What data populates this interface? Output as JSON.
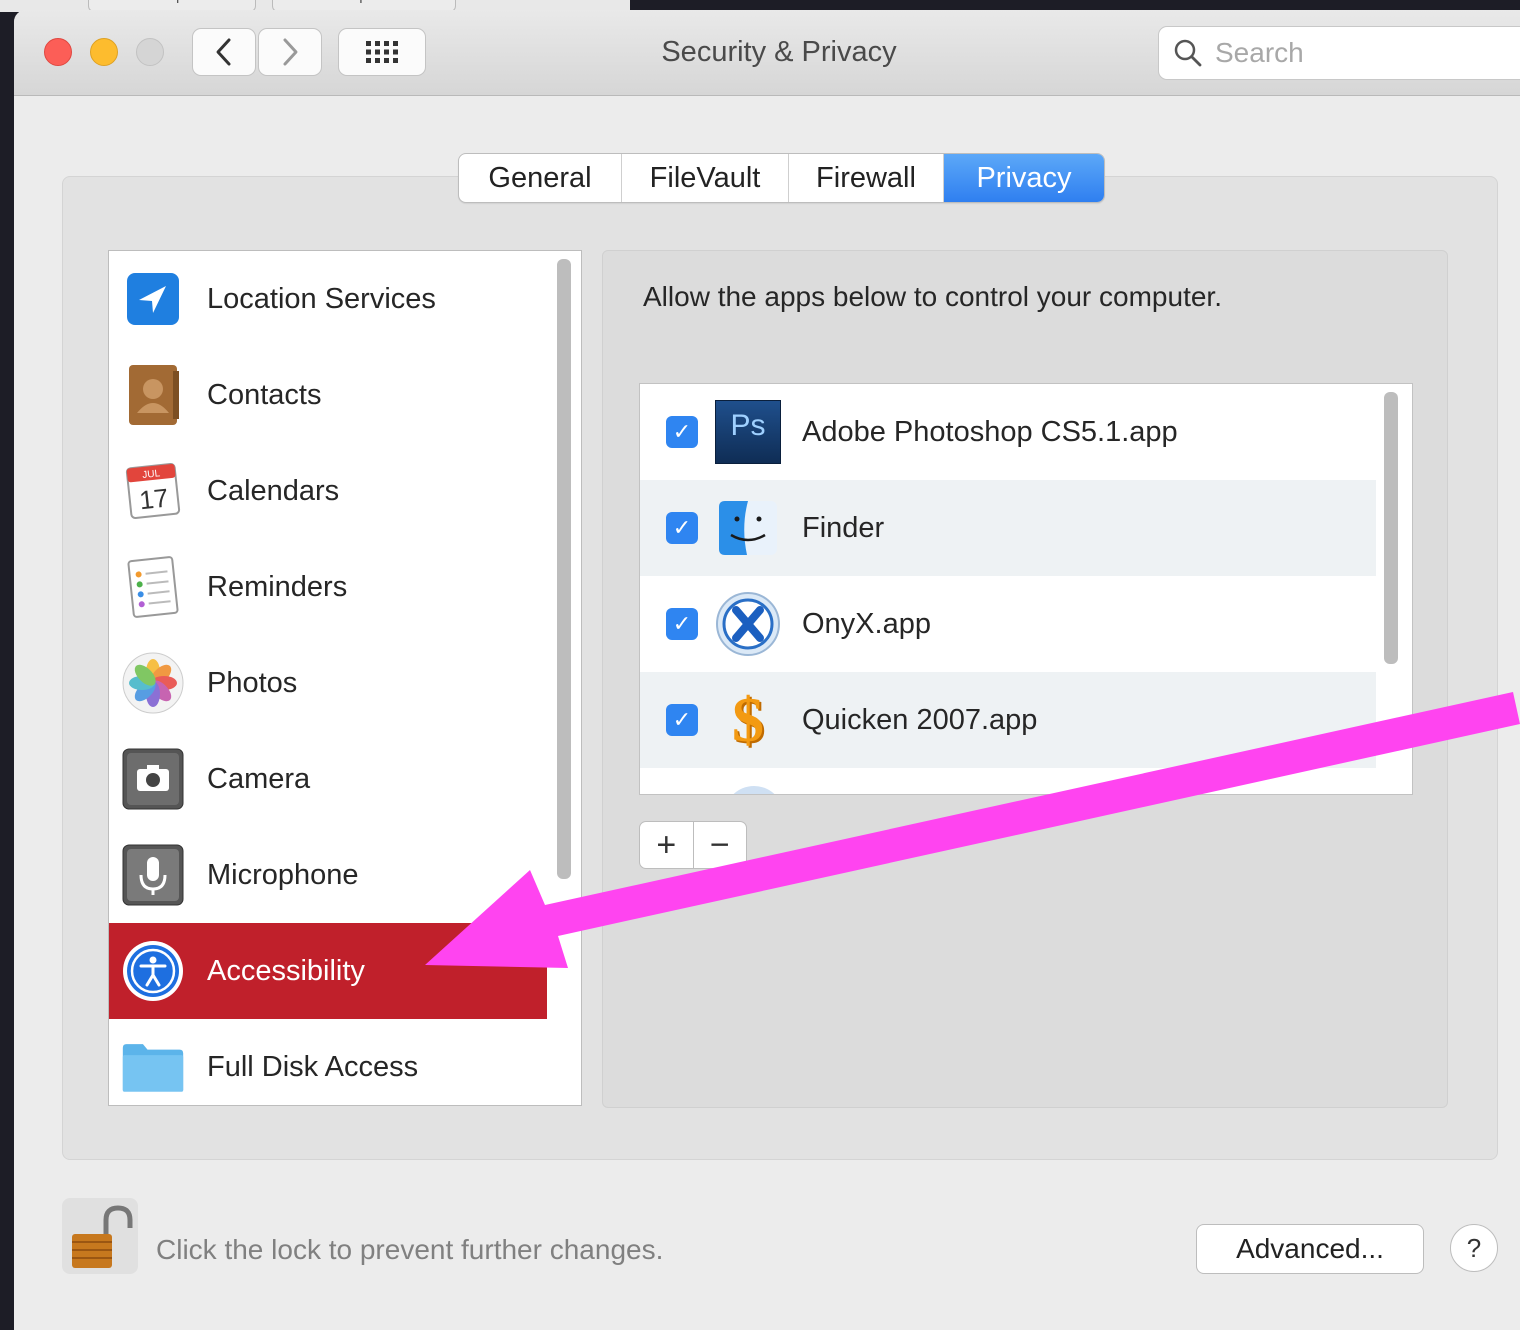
{
  "background_tabs": [
    "Custom Report",
    "Software Update"
  ],
  "window": {
    "title": "Security & Privacy"
  },
  "search": {
    "placeholder": "Search"
  },
  "tabs": [
    {
      "label": "General",
      "active": false
    },
    {
      "label": "FileVault",
      "active": false
    },
    {
      "label": "Firewall",
      "active": false
    },
    {
      "label": "Privacy",
      "active": true
    }
  ],
  "privacy_list": [
    {
      "label": "Location Services",
      "icon": "location-arrow-icon",
      "selected": false
    },
    {
      "label": "Contacts",
      "icon": "contacts-book-icon",
      "selected": false
    },
    {
      "label": "Calendars",
      "icon": "calendar-icon",
      "selected": false
    },
    {
      "label": "Reminders",
      "icon": "reminders-icon",
      "selected": false
    },
    {
      "label": "Photos",
      "icon": "photos-flower-icon",
      "selected": false
    },
    {
      "label": "Camera",
      "icon": "camera-icon",
      "selected": false
    },
    {
      "label": "Microphone",
      "icon": "microphone-icon",
      "selected": false
    },
    {
      "label": "Accessibility",
      "icon": "accessibility-icon",
      "selected": true
    },
    {
      "label": "Full Disk Access",
      "icon": "folder-icon",
      "selected": false
    }
  ],
  "detail": {
    "description": "Allow the apps below to control your computer.",
    "apps": [
      {
        "name": "Adobe Photoshop CS5.1.app",
        "checked": true,
        "icon": "photoshop-icon",
        "icon_text": "Ps"
      },
      {
        "name": "Finder",
        "checked": true,
        "icon": "finder-icon"
      },
      {
        "name": "OnyX.app",
        "checked": true,
        "icon": "onyx-icon"
      },
      {
        "name": "Quicken 2007.app",
        "checked": true,
        "icon": "quicken-icon"
      }
    ],
    "add_label": "+",
    "remove_label": "−"
  },
  "calendar_icon": {
    "month": "JUL",
    "day": "17"
  },
  "footer": {
    "lock_text": "Click the lock to prevent further changes.",
    "advanced_label": "Advanced...",
    "help_label": "?"
  },
  "annotation_arrow_color": "#ff44f0"
}
